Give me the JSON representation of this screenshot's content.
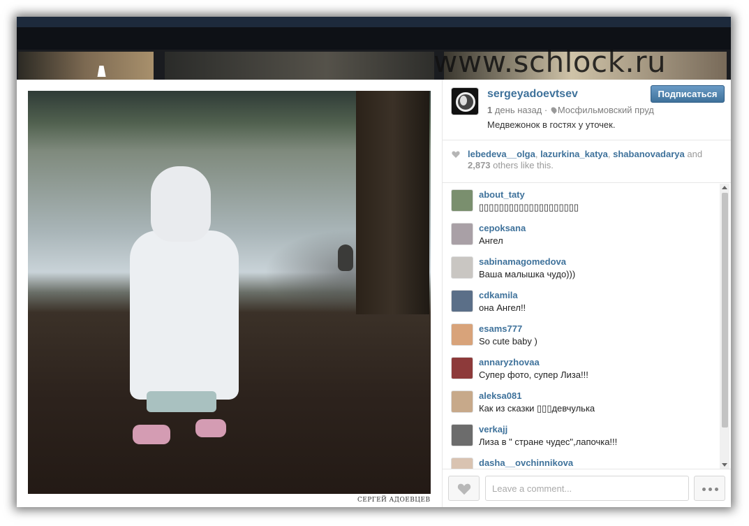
{
  "background": {
    "watermark": "www.schlock.ru"
  },
  "post": {
    "author": "sergeyadoevtsev",
    "follow_label": "Подписаться",
    "time_prefix": "1",
    "time_rest": " день назад",
    "location": "Мосфильмовский пруд",
    "caption": "Медвежонок в гостях у уточек.",
    "photo_caption": "СЕРГЕЙ АДОЕВЦЕВ"
  },
  "likes": {
    "names": [
      "lebedeva__olga",
      "lazurkina_katya",
      "shabanovadarya"
    ],
    "and_label": "and",
    "count": "2,873",
    "tail": "others like this."
  },
  "comments": [
    {
      "user": "about_taty",
      "text": "▯▯▯▯▯▯▯▯▯▯▯▯▯▯▯▯▯▯▯▯",
      "avatar_color": "#7a8f6e"
    },
    {
      "user": "cepoksana",
      "text": "Ангел",
      "avatar_color": "#a9a0a6"
    },
    {
      "user": "sabinamagomedova",
      "text": "Ваша малышка чудо)))",
      "avatar_color": "#c9c6c2"
    },
    {
      "user": "cdkamila",
      "text": "она Ангел!!",
      "avatar_color": "#5b6f88"
    },
    {
      "user": "esams777",
      "text": "So cute baby )",
      "avatar_color": "#d8a37a"
    },
    {
      "user": "annaryzhovaa",
      "text": "Супер фото, супер Лиза!!!",
      "avatar_color": "#8d3a3a"
    },
    {
      "user": "aleksa081",
      "text": "Как из сказки ▯▯▯девчулька",
      "avatar_color": "#c7a98a"
    },
    {
      "user": "verkajj",
      "text": "Лиза в \" стране чудес\",лапочка!!!",
      "avatar_color": "#6c6c6c"
    },
    {
      "user": "dasha__ovchinnikova",
      "text": "",
      "avatar_color": "#d9c3b1"
    }
  ],
  "footer": {
    "comment_placeholder": "Leave a comment..."
  },
  "colors": {
    "link": "#3f729b",
    "follow_button": "#3f729b"
  }
}
